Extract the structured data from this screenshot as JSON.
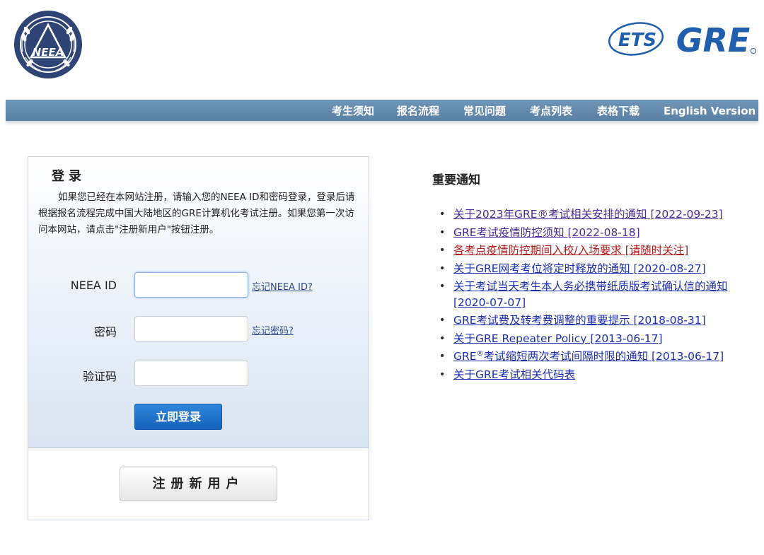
{
  "logos": {
    "neea_text": "NEEA",
    "ets_text": "ETS",
    "gre_text": "GRE"
  },
  "nav": {
    "items": [
      {
        "label": "考生须知"
      },
      {
        "label": "报名流程"
      },
      {
        "label": "常见问题"
      },
      {
        "label": "考点列表"
      },
      {
        "label": "表格下载"
      },
      {
        "label": "English Version"
      }
    ]
  },
  "login": {
    "title": "登录",
    "description": "如果您已经在本网站注册，请输入您的NEEA ID和密码登录，登录后请根据报名流程完成中国大陆地区的GRE计算机化考试注册。如果您第一次访问本网站，请点击\"注册新用户\"按钮注册。",
    "neea_id_label": "NEEA ID",
    "neea_id_value": "",
    "forgot_id": "忘记NEEA ID?",
    "password_label": "密码",
    "password_value": "",
    "forgot_password": "忘记密码?",
    "captcha_label": "验证码",
    "captcha_value": "",
    "login_button": "立即登录",
    "register_button": "注册新用户"
  },
  "notices": {
    "title": "重要通知",
    "items": [
      {
        "text": "关于2023年GRE®考试相关安排的通知 [2022-09-23]",
        "style": "visited"
      },
      {
        "text": "GRE考试疫情防控须知 [2022-08-18]",
        "style": "visited"
      },
      {
        "text": "各考点疫情防控期间入校/入场要求 [请随时关注]",
        "style": "red"
      },
      {
        "text": "关于GRE网考考位将定时释放的通知 [2020-08-27]",
        "style": "blue"
      },
      {
        "text": "关于考试当天考生本人务必携带纸质版考试确认信的通知 [2020-07-07]",
        "style": "blue"
      },
      {
        "text": "GRE考试费及转考费调整的重要提示 [2018-08-31]",
        "style": "blue"
      },
      {
        "text": "关于GRE Repeater Policy [2013-06-17]",
        "style": "blue"
      },
      {
        "text_prefix": "GRE",
        "text_sup": "®",
        "text_suffix": "考试缩短两次考试间隔时限的通知 [2013-06-17]",
        "style": "blue"
      },
      {
        "text": "关于GRE考试相关代码表",
        "style": "blue"
      }
    ]
  },
  "colors": {
    "nav_bg": "#6389ae",
    "login_button": "#1f6fc7",
    "link_visited": "#4b2a99",
    "link_blue": "#1c2fb0",
    "link_red": "#b11c1c",
    "ets_gre_blue": "#1f5fae"
  }
}
